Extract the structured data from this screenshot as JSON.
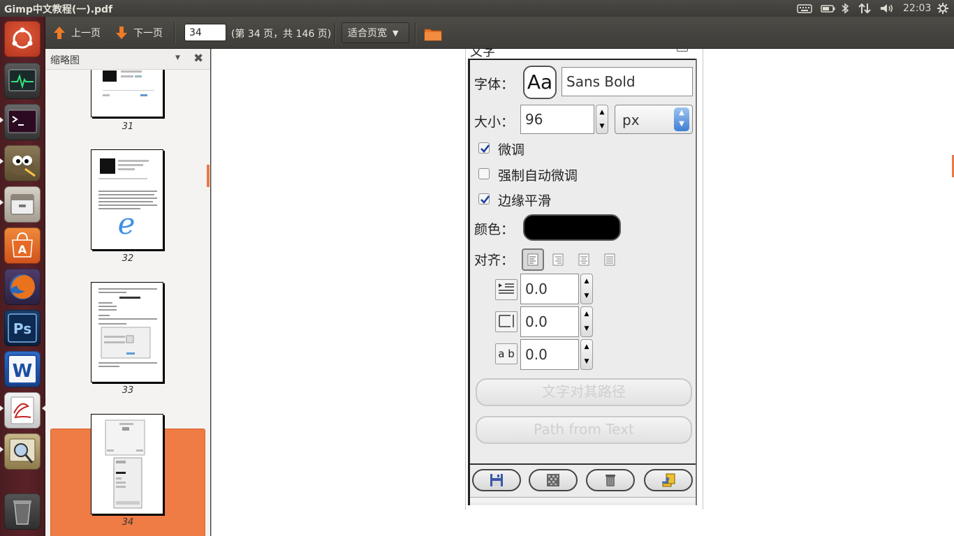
{
  "window": {
    "title": "Gimp中文教程(一).pdf"
  },
  "top_panel": {
    "clock": "22:03",
    "tray_icons": [
      "keyboard-icon",
      "battery-icon",
      "bluetooth-icon",
      "network-icon",
      "volume-icon",
      "gear-icon"
    ]
  },
  "launcher": {
    "items": [
      "dash-home",
      "system-monitor",
      "terminal",
      "gimp",
      "file-manager",
      "software-center",
      "firefox",
      "photoshop",
      "wps-writer",
      "document-viewer",
      "image-viewer",
      "trash"
    ]
  },
  "toolbar": {
    "prev_label": "上一页",
    "next_label": "下一页",
    "page_value": "34",
    "page_count": "(第 34 页，共 146 页)",
    "zoom_label": "适合页宽"
  },
  "sidebar": {
    "title": "缩略图",
    "thumbnails": [
      {
        "num": "31"
      },
      {
        "num": "32"
      },
      {
        "num": "33"
      },
      {
        "num": "34",
        "selected": true
      }
    ]
  },
  "gimp_dialog": {
    "font_label": "字体：",
    "font_preview": "Aa",
    "font_value": "Sans Bold",
    "size_label": "大小：",
    "size_value": "96",
    "unit_value": "px",
    "hinting_label": "微调",
    "hinting_checked": true,
    "force_autohint_label": "强制自动微调",
    "force_autohint_checked": false,
    "antialias_label": "边缘平滑",
    "antialias_checked": true,
    "color_label": "颜色：",
    "color_value": "#000000",
    "justify_label": "对齐：",
    "indent_value": "0.0",
    "line_spacing_value": "0.0",
    "letter_spacing_value": "0.0",
    "letter_spacing_icon_text": "a b",
    "text_along_path_label": "文字对其路径",
    "path_from_text_label": "Path from Text"
  },
  "colors": {
    "accent": "#ee7c44",
    "launcher_bg": "#5a2228",
    "panel_bg": "#3c3b37"
  }
}
